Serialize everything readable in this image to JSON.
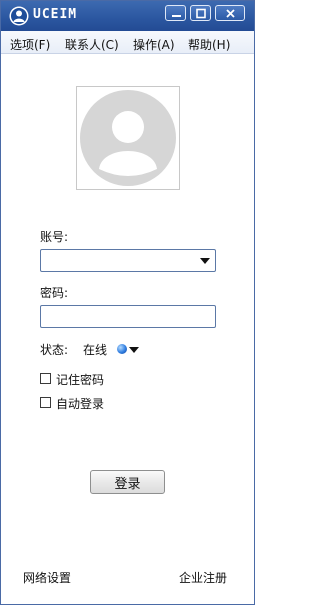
{
  "app": {
    "title": "UCEIM"
  },
  "menu": [
    {
      "label": "选项(F)"
    },
    {
      "label": "联系人(C)"
    },
    {
      "label": "操作(A)"
    },
    {
      "label": "帮助(H)"
    }
  ],
  "login": {
    "account_label": "账号:",
    "account_value": "",
    "password_label": "密码:",
    "password_value": "",
    "status_label": "状态:",
    "status_value": "在线",
    "remember_label": "记住密码",
    "remember_checked": false,
    "autologin_label": "自动登录",
    "autologin_checked": false,
    "login_button": "登录"
  },
  "footer": {
    "network_settings": "网络设置",
    "enterprise_register": "企业注册"
  },
  "colors": {
    "titlebar": "#2b56a0",
    "status_online": "#2f7de0"
  }
}
